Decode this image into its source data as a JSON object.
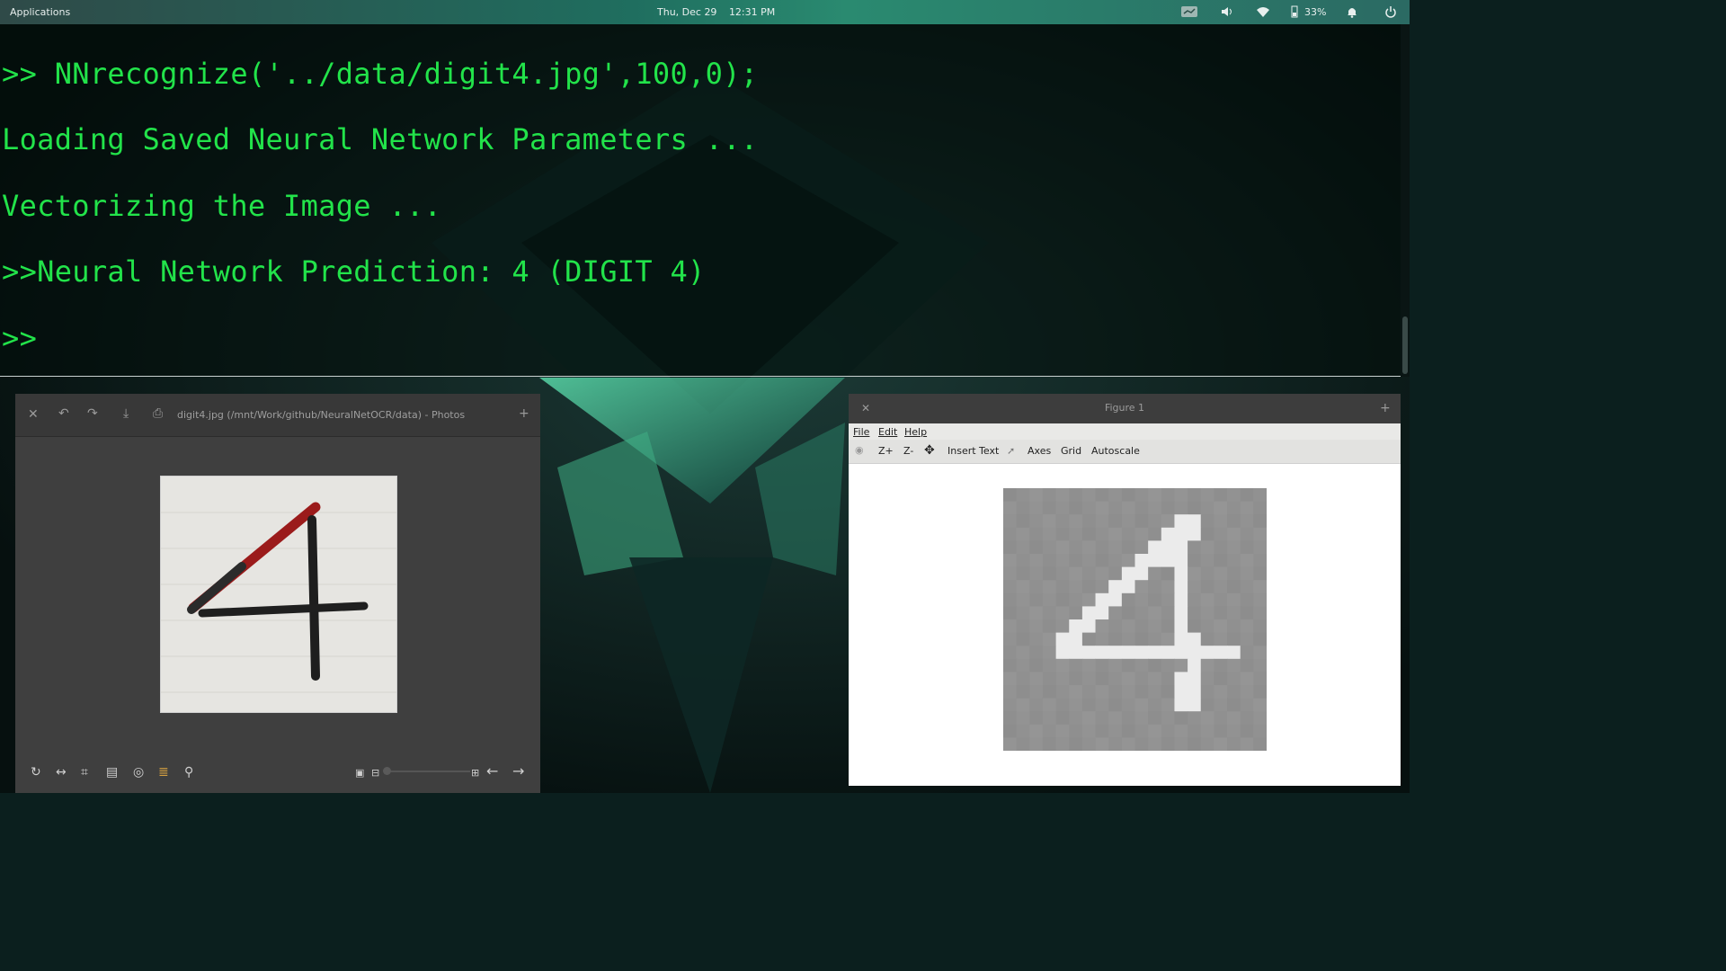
{
  "panel": {
    "applications_label": "Applications",
    "date": "Thu, Dec 29",
    "time": "12:31 PM",
    "battery_percent": "33%"
  },
  "terminal": {
    "lines": [
      ">> NNrecognize('../data/digit4.jpg',100,0);",
      "Loading Saved Neural Network Parameters ...",
      "Vectorizing the Image ...",
      ">>Neural Network Prediction: 4 (DIGIT 4)",
      ">>"
    ],
    "text_color": "#22e34a"
  },
  "photos": {
    "title": "digit4.jpg (/mnt/Work/github/NeuralNetOCR/data) - Photos"
  },
  "figure": {
    "title": "Figure 1",
    "menu": {
      "file": "File",
      "edit": "Edit",
      "help": "Help"
    },
    "toolbar": {
      "zoom_in": "Z+",
      "zoom_out": "Z-",
      "insert_text": "Insert Text",
      "axes": "Axes",
      "grid": "Grid",
      "autoscale": "Autoscale"
    },
    "image_pixels": [
      "00000000000000000000",
      "00000000000000000000",
      "00000000000009900000",
      "00000000000099900000",
      "00000000000999000000",
      "00000000009999000000",
      "00000000099009000000",
      "00000000990009000000",
      "00000009900009000000",
      "00000099000009000000",
      "00000990000009000000",
      "00009900000009900000",
      "00009999999999999900",
      "00000000000000900000",
      "00000000000009900000",
      "00000000000009900000",
      "00000000000009900000",
      "00000000000000000000",
      "00000000000000000000",
      "00000000000000000000"
    ]
  }
}
